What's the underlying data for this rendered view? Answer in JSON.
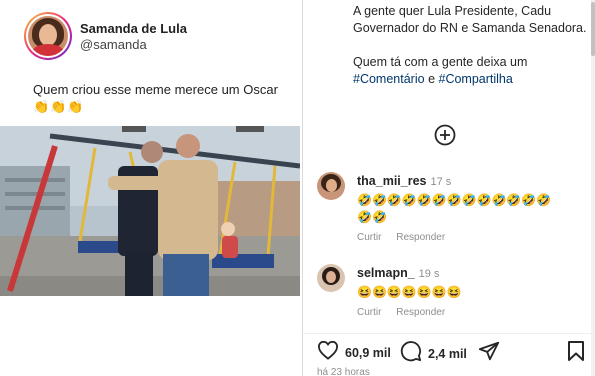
{
  "tweet": {
    "display_name": "Samanda de Lula",
    "handle": "@samanda",
    "text": "Quem criou esse meme merece um Oscar",
    "emojis": "👏👏👏"
  },
  "caption": {
    "paragraph1": "A gente quer Lula Presidente, Cadu Governador do RN e Samanda Senadora.",
    "paragraph2_prefix": "Quem tá com a gente deixa um",
    "hashtag1": "#Comentário",
    "connector": "e",
    "hashtag2": "#Compartilha"
  },
  "comments": [
    {
      "username": "tha_mii_res",
      "time": "17 s",
      "text": "🤣🤣🤣🤣🤣🤣🤣🤣🤣🤣🤣🤣🤣🤣🤣",
      "like_label": "Curtir",
      "reply_label": "Responder"
    },
    {
      "username": "selmapn_",
      "time": "19 s",
      "text": "😆😆😆😆😆😆😆",
      "like_label": "Curtir",
      "reply_label": "Responder"
    }
  ],
  "actions": {
    "likes": "60,9 mil",
    "comments": "2,4 mil"
  },
  "timestamp": "há 23 horas",
  "colors": {
    "hashtag": "#00376b",
    "muted": "#8e8e8e"
  },
  "icons": [
    "add-comment-icon",
    "heart-icon",
    "comment-icon",
    "share-icon",
    "bookmark-icon"
  ]
}
